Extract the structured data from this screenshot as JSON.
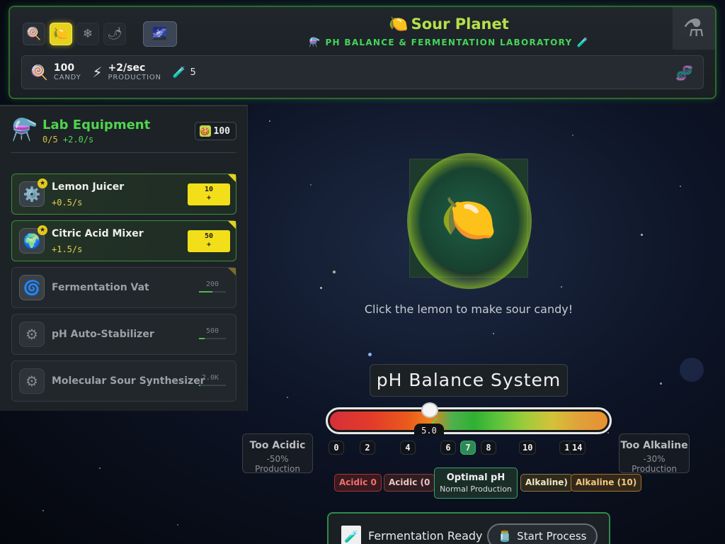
{
  "header": {
    "planets": [
      {
        "icon": "🍭",
        "name": "candy-planet"
      },
      {
        "icon": "🍋",
        "name": "sour-planet"
      },
      {
        "icon": "❄",
        "name": "ice-planet"
      },
      {
        "icon": "🌶",
        "name": "spicy-planet"
      }
    ],
    "galaxy_icon": "🌌",
    "title_icon": "🍋",
    "title": "Sour Planet",
    "subtitle": "PH BALANCE & FERMENTATION LABORATORY",
    "subtitle_left_icon": "⚗️",
    "subtitle_right_icon": "🧪",
    "corner_icon": "⚗"
  },
  "stats": {
    "candy_icon": "🍭",
    "candy_value": "100",
    "candy_label": "CANDY",
    "production_icon": "⚡",
    "production_value": "+2/sec",
    "production_label": "PRODUCTION",
    "tube_icon": "🧪",
    "tube_value": "5",
    "dna_icon": "🧬"
  },
  "panel": {
    "title_icon": "⚗️",
    "title": "Lab Equipment",
    "owned": "0/5",
    "rate": "+2.0/s",
    "count_icon": "🍪",
    "count": "100",
    "items": [
      {
        "name": "Lemon Juicer",
        "rate": "+0.5/s",
        "cost": "10",
        "plus": "+",
        "icon": "⚙️",
        "badge": "★",
        "owned": true
      },
      {
        "name": "Citric Acid Mixer",
        "rate": "+1.5/s",
        "cost": "50",
        "plus": "+",
        "icon": "🌍",
        "badge": "★",
        "owned": true
      },
      {
        "name": "Fermentation Vat",
        "cost": "200",
        "progress": 0.5,
        "icon": "🌀",
        "owned": false
      },
      {
        "name": "pH Auto-Stabilizer",
        "cost": "500",
        "progress": 0.2,
        "icon": "⚙",
        "owned": false
      },
      {
        "name": "Molecular Sour Synthesizer",
        "cost": "2.0K",
        "progress": 0.05,
        "icon": "⚙",
        "owned": false
      }
    ]
  },
  "lemon": {
    "icon": "🍋",
    "hint": "Click the lemon to make sour candy!"
  },
  "ph": {
    "title": "pH Balance System",
    "value": "5.0",
    "level": 0.36,
    "check_icon": "✓",
    "ticks": [
      "0",
      "2",
      "4",
      "6",
      "7",
      "8",
      "10",
      "1",
      "14"
    ],
    "highlight_tick": "7",
    "left_card": {
      "title": "Too Acidic",
      "desc": "-50% Production"
    },
    "right_card": {
      "title": "Too Alkaline",
      "desc": "-30% Production"
    },
    "zones": {
      "acid0": "Acidic 0",
      "acid": "Acidic (0",
      "optimal_title": "Optimal pH",
      "optimal_desc": "Normal Production",
      "alk": "Alkaline)",
      "alk10": "Alkaline (10)"
    }
  },
  "ferment": {
    "jar_icon": "🧪",
    "status": "Fermentation Ready",
    "button_icon": "🫙",
    "button_label": "Start Process"
  },
  "colors": {
    "accent_green": "#4fd44f",
    "accent_yellow": "#f2df1a",
    "title_lime": "#b6e04a"
  }
}
